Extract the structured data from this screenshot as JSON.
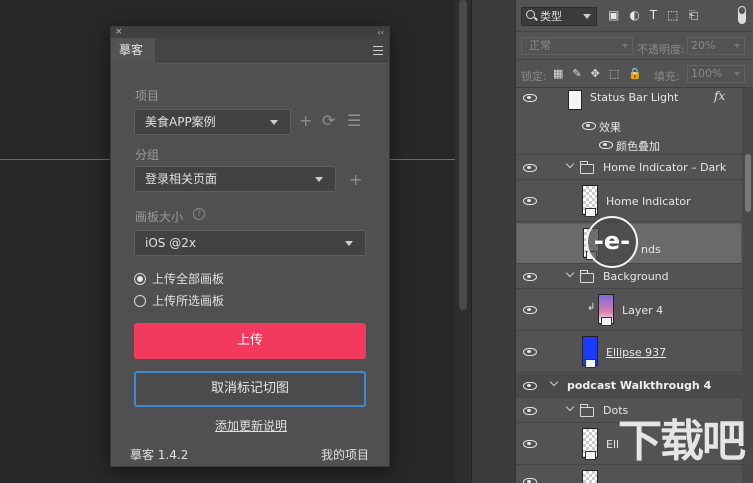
{
  "plugin": {
    "close": "×",
    "collapse": "‹‹",
    "tab": "摹客",
    "project_label": "项目",
    "project_value": "美食APP案例",
    "group_label": "分组",
    "group_value": "登录相关页面",
    "artboard_label": "画板大小",
    "artboard_value": "iOS @2x",
    "help": "?",
    "radio_all": "上传全部画板",
    "radio_selected": "上传所选画板",
    "upload": "上传",
    "cancel_mark": "取消标记切图",
    "add_notes": "添加更新说明",
    "version": "摹客 1.4.2",
    "my_projects": "我的项目",
    "add_glyph": "+",
    "refresh_glyph": "⟳",
    "list_glyph": "☰"
  },
  "layers_panel": {
    "filter_label": "类型",
    "filter_icons": "▣◐T⬚⎗",
    "blend_mode": "正常",
    "opacity_label": "不透明度:",
    "opacity_value": "20%",
    "lock_label": "锁定:",
    "lock_icons": "▦✎✥⬚🔒",
    "fill_label": "填充:",
    "fill_value": "100%",
    "fx": "fx",
    "rows": {
      "status_bar": "Status Bar Light",
      "effects": "效果",
      "color_overlay": "颜色叠加",
      "home_indicator_group": "Home Indicator – Dark",
      "home_indicator": "Home Indicator",
      "bounds": "nds",
      "background": "Background",
      "layer4": "Layer 4",
      "ellipse": "Ellipse 937",
      "podcast": "podcast Walkthrough 4",
      "dots": "Dots",
      "ell": "Ell"
    }
  },
  "magnifier_label": "-e-",
  "watermark": "下载吧"
}
